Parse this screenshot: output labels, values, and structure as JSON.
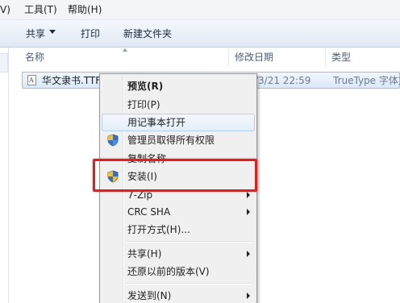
{
  "menubar": {
    "items": [
      "V)",
      "工具(T)",
      "帮助(H)"
    ]
  },
  "toolbar": {
    "share_label": "共享",
    "print_label": "打印",
    "new_folder_label": "新建文件夹"
  },
  "columns": {
    "name": "名称",
    "modified": "修改日期",
    "type": "类型"
  },
  "file": {
    "name": "华文隶书.TTF",
    "modified": "/3/21 22:59",
    "type": "TrueType 字体文",
    "icon": "font-file-icon"
  },
  "context_menu": {
    "items": [
      {
        "label": "预览(R)",
        "default": true
      },
      {
        "label": "打印(P)"
      },
      {
        "label": "用记事本打开",
        "hover": true
      },
      {
        "label": "管理员取得所有权限",
        "icon": "uac-shield-icon"
      },
      {
        "label": "复制名称"
      },
      {
        "label": "安装(I)",
        "icon": "uac-shield-icon",
        "highlighted": true
      },
      {
        "label": "7-Zip",
        "submenu": true
      },
      {
        "label": "CRC SHA",
        "submenu": true
      },
      {
        "label": "打开方式(H)..."
      },
      {
        "label": "共享(H)",
        "submenu": true
      },
      {
        "label": "还原以前的版本(V)"
      },
      {
        "label": "发送到(N)",
        "submenu": true
      }
    ]
  },
  "colors": {
    "annotation": "#e02020",
    "selection": "#dbe8f9",
    "menu_background": "#f0f0f0"
  }
}
